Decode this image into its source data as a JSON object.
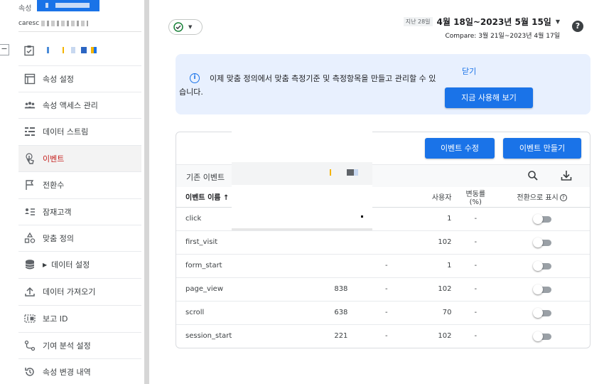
{
  "sidebar": {
    "property_label": "속성",
    "account_text": "caresc",
    "items": [
      {
        "label": "속성 설정",
        "icon": "window-icon"
      },
      {
        "label": "속성 액세스 관리",
        "icon": "people-icon"
      },
      {
        "label": "데이터 스트림",
        "icon": "streams-icon"
      },
      {
        "label": "이벤트",
        "icon": "touch-icon"
      },
      {
        "label": "전환수",
        "icon": "flag-icon"
      },
      {
        "label": "잠재고객",
        "icon": "audience-icon"
      },
      {
        "label": "맞춤 정의",
        "icon": "shapes-icon"
      },
      {
        "label": "데이터 설정",
        "icon": "database-icon"
      },
      {
        "label": "데이터 가져오기",
        "icon": "upload-icon"
      },
      {
        "label": "보고 ID",
        "icon": "reporting-id-icon"
      },
      {
        "label": "기여 분석 설정",
        "icon": "attribution-icon"
      },
      {
        "label": "속성 변경 내역",
        "icon": "history-icon"
      }
    ],
    "active_item": "이벤트",
    "collapse_label": "−"
  },
  "header": {
    "date_chip": "지난 28일",
    "date_range": "4월 18일~2023년 5월 15일",
    "compare": "Compare: 3월 21일~2023년 4월 17일",
    "help_label": "?"
  },
  "banner": {
    "message": "이제 맞춤 정의에서 맞춤 측정기준 및 측정항목을 만들고 관리할 수 있습니다.",
    "dismiss_label": "닫기",
    "try_label": "지금 사용해 보기",
    "info_glyph": "i"
  },
  "card": {
    "modify_label": "이벤트 수정",
    "create_label": "이벤트 만들기",
    "existing_title": "기존 이벤트",
    "columns": {
      "name": "이벤트 이름 ↑",
      "users": "사용자",
      "change_pct": "변동률(%)",
      "mark_conversion": "전환으로 표시"
    },
    "rows": [
      {
        "name": "click",
        "count": "",
        "count_change": "",
        "users": "1",
        "users_change": "-"
      },
      {
        "name": "first_visit",
        "count": "",
        "count_change": "",
        "users": "102",
        "users_change": "-"
      },
      {
        "name": "form_start",
        "count": "",
        "count_change": "-",
        "users": "1",
        "users_change": "-"
      },
      {
        "name": "page_view",
        "count": "838",
        "count_change": "-",
        "users": "102",
        "users_change": "-"
      },
      {
        "name": "scroll",
        "count": "638",
        "count_change": "-",
        "users": "70",
        "users_change": "-"
      },
      {
        "name": "session_start",
        "count": "221",
        "count_change": "-",
        "users": "102",
        "users_change": "-"
      }
    ]
  },
  "colors": {
    "accent": "#1a73e8",
    "banner_bg": "#e8f0fe",
    "active_text": "#c5221f"
  }
}
